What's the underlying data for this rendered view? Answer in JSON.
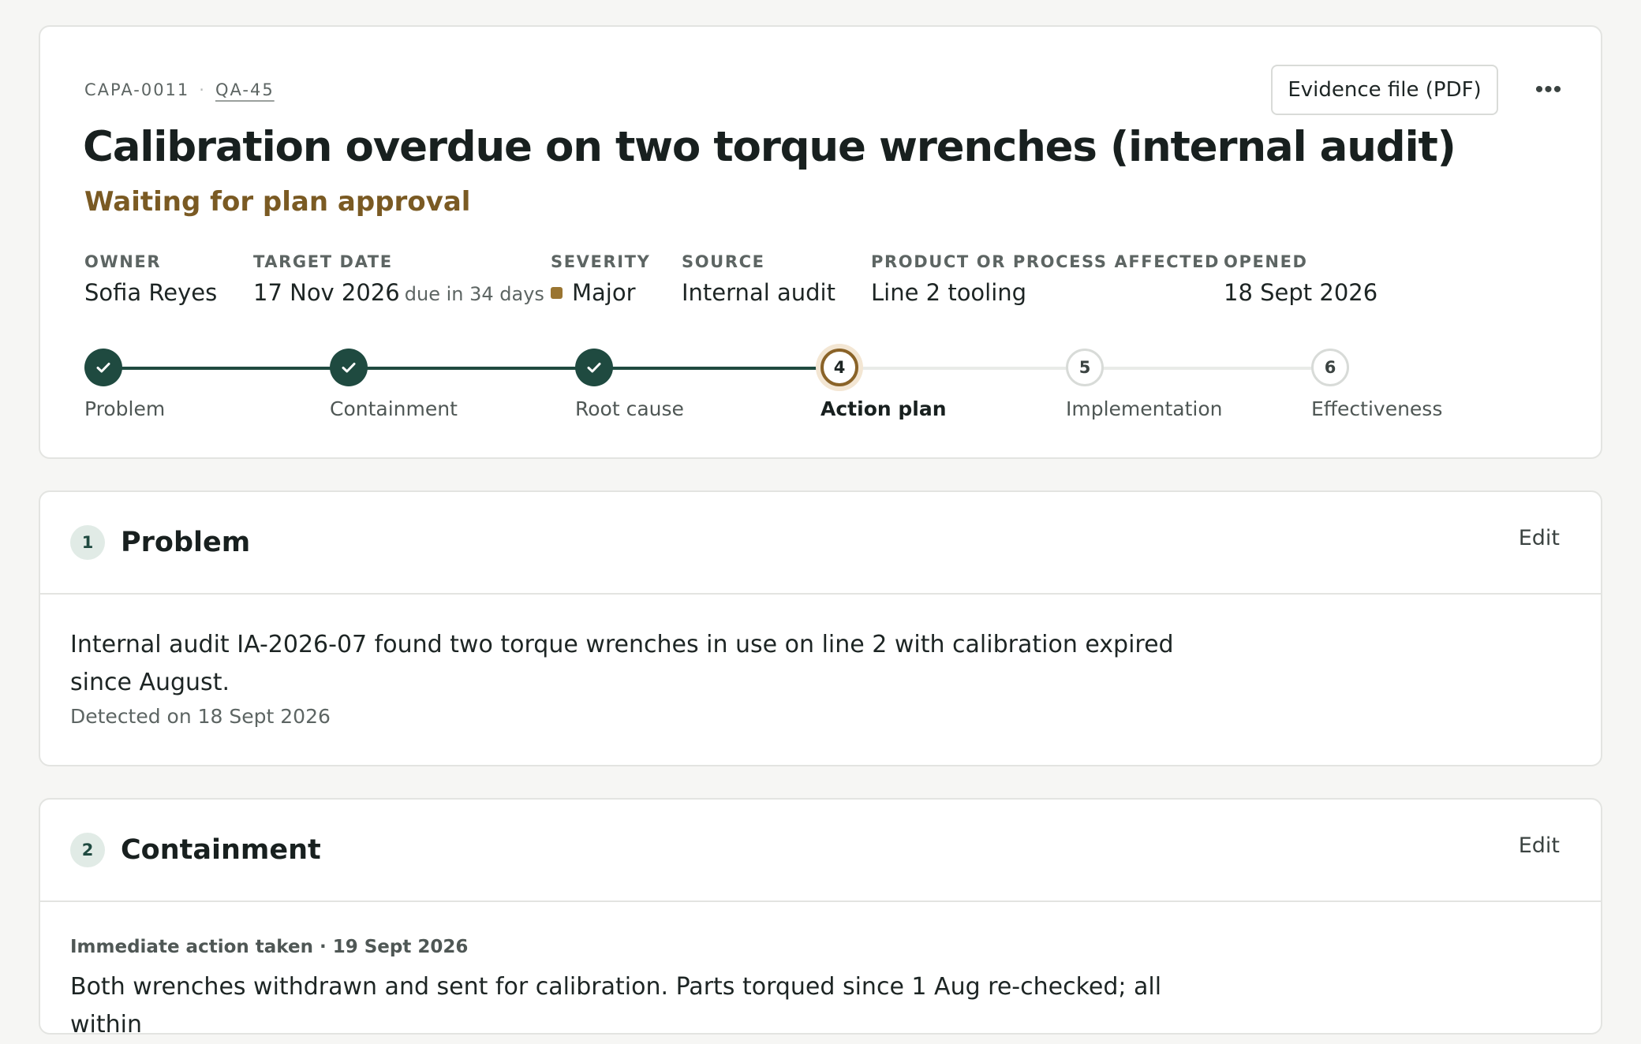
{
  "header": {
    "capa_id": "CAPA-0011",
    "separator": "·",
    "ref_link": "QA-45",
    "evidence_button": "Evidence file (PDF)",
    "more_button": "•••",
    "title": "Calibration overdue on two torque wrenches (internal audit)",
    "status": "Waiting for plan approval",
    "status_color": "#7a5a23"
  },
  "meta": {
    "owner": {
      "label": "OWNER",
      "value": "Sofia Reyes"
    },
    "target_date": {
      "label": "TARGET DATE",
      "value": "17 Nov 2026",
      "due": "due in 34 days"
    },
    "severity": {
      "label": "SEVERITY",
      "value": "Major",
      "color": "#9a7531"
    },
    "source": {
      "label": "SOURCE",
      "value": "Internal audit"
    },
    "product": {
      "label": "PRODUCT OR PROCESS AFFECTED",
      "value": "Line 2 tooling"
    },
    "opened": {
      "label": "OPENED",
      "value": "18 Sept 2026"
    }
  },
  "stepper": {
    "steps": [
      {
        "number": "1",
        "label": "Problem",
        "state": "done",
        "icon": "check-icon"
      },
      {
        "number": "2",
        "label": "Containment",
        "state": "done",
        "icon": "check-icon"
      },
      {
        "number": "3",
        "label": "Root cause",
        "state": "done",
        "icon": "check-icon"
      },
      {
        "number": "4",
        "label": "Action plan",
        "state": "current"
      },
      {
        "number": "5",
        "label": "Implementation",
        "state": "todo"
      },
      {
        "number": "6",
        "label": "Effectiveness",
        "state": "todo"
      }
    ],
    "done_color": "#1f4a40",
    "current_color": "#8a6328"
  },
  "sections": {
    "problem": {
      "number": "1",
      "title": "Problem",
      "edit": "Edit",
      "text": "Internal audit IA-2026-07 found two torque wrenches in use on line 2 with calibration expired since August.",
      "detected": "Detected on 18 Sept 2026"
    },
    "containment": {
      "number": "2",
      "title": "Containment",
      "edit": "Edit",
      "kicker": "Immediate action taken · 19 Sept 2026",
      "text": "Both wrenches withdrawn and sent for calibration. Parts torqued since 1 Aug re-checked; all within"
    }
  }
}
